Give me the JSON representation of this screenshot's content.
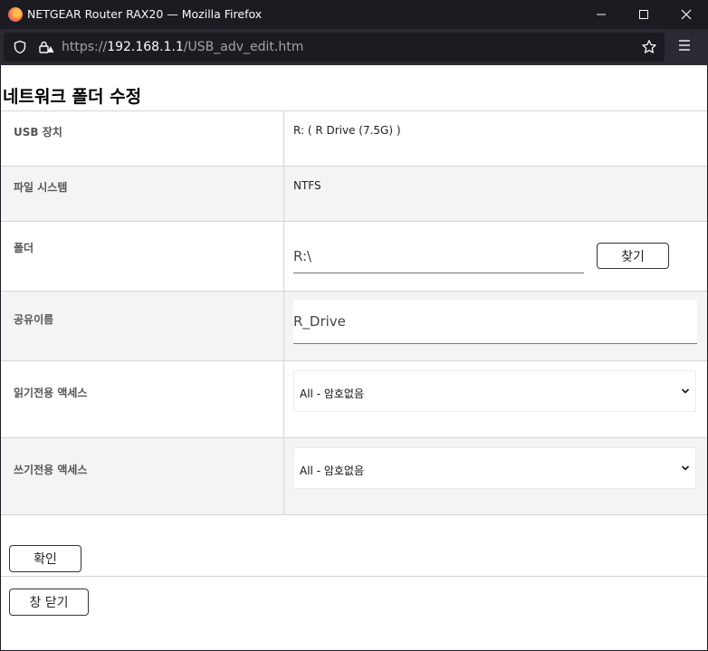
{
  "window": {
    "title": "NETGEAR Router RAX20 — Mozilla Firefox"
  },
  "browser": {
    "url_prefix": "https://",
    "url_host": "192.168.1.1",
    "url_path": "/USB_adv_edit.htm"
  },
  "page": {
    "heading": "네트워크 폴더 수정",
    "usb_device": {
      "label": "USB 장치",
      "value": "R: ( R Drive (7.5G) )"
    },
    "filesystem": {
      "label": "파일 시스템",
      "value": "NTFS"
    },
    "folder": {
      "label": "폴더",
      "value": "R:\\",
      "browse_label": "찾기"
    },
    "share_name": {
      "label": "공유이름",
      "value": "R_Drive"
    },
    "read_access": {
      "label": "읽기전용 액세스",
      "value": "All - 암호없음"
    },
    "write_access": {
      "label": "쓰기전용 액세스",
      "value": "All - 암호없음"
    },
    "apply_label": "확인",
    "close_label": "창 닫기"
  }
}
